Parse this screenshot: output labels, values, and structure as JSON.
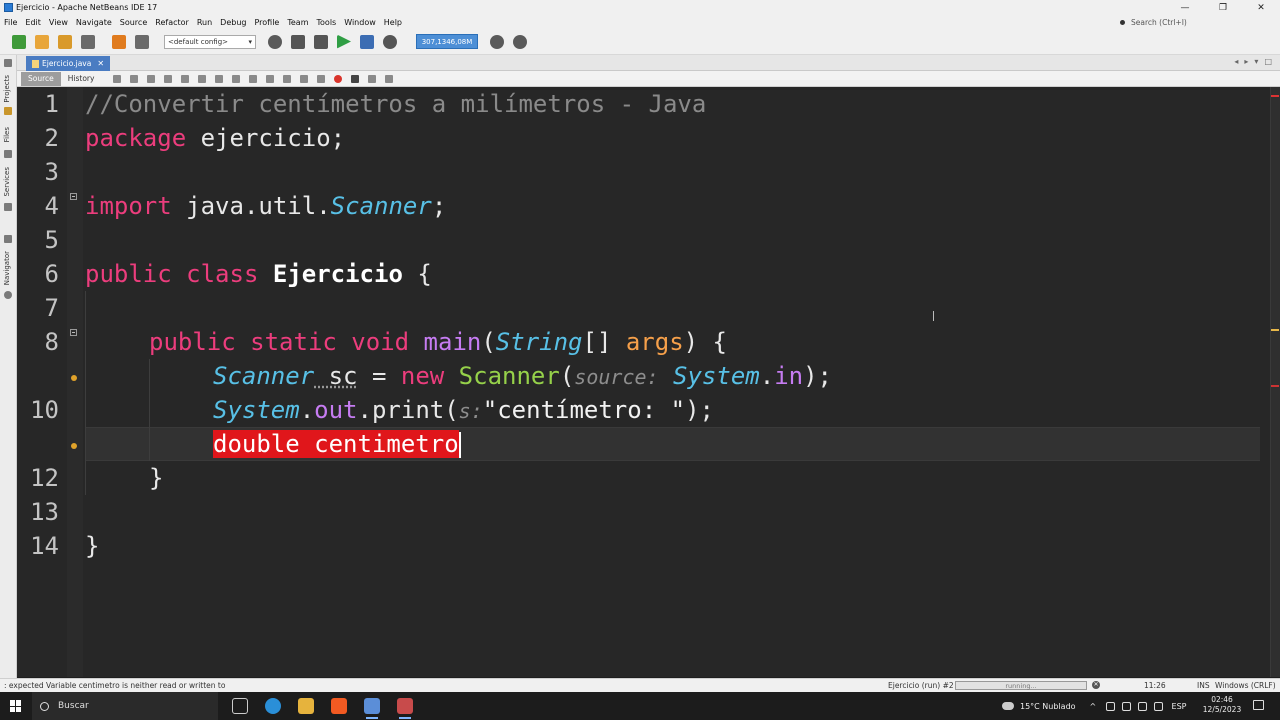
{
  "window": {
    "title": "Ejercicio - Apache NetBeans IDE 17",
    "controls": [
      "—",
      "❐",
      "✕"
    ]
  },
  "menu": {
    "items": [
      "File",
      "Edit",
      "View",
      "Navigate",
      "Source",
      "Refactor",
      "Run",
      "Debug",
      "Profile",
      "Team",
      "Tools",
      "Window",
      "Help"
    ],
    "search_placeholder": "Search (Ctrl+I)"
  },
  "toolbar": {
    "config_value": "<default config>",
    "memory_label": "307,1346,08M",
    "colors": {
      "new_file": "#3f9a3a",
      "new_project": "#e8a63b",
      "open": "#d99a2b",
      "close": "#6a6a6a",
      "undo": "#e07b1e",
      "redo": "#6a6a6a",
      "build": "#555555",
      "clean": "#555555",
      "run": "#2f9e44",
      "debug": "#3c6db3",
      "profile": "#555555",
      "gc": "#5a5a5a"
    }
  },
  "side_panels": [
    "Projects",
    "Files",
    "Services",
    "Navigator"
  ],
  "editor_tab": {
    "file_name": "Ejercicio.java",
    "close": "✕"
  },
  "editor_toolbar": {
    "source_tab": "Source",
    "history_tab": "History"
  },
  "editor": {
    "line_numbers": [
      "1",
      "2",
      "3",
      "4",
      "5",
      "6",
      "7",
      "8",
      "",
      "10",
      "",
      "12",
      "13",
      "14"
    ],
    "lines": {
      "l1": "//Convertir centímetros a milímetros - Java",
      "l2_kw": "package",
      "l2_rest": " ejercicio;",
      "l4_kw": "import",
      "l4_pkg": " java.util.",
      "l4_type": "Scanner",
      "l4_end": ";",
      "l6_kw": "public class ",
      "l6_name": "Ejercicio",
      "l6_end": " {",
      "l8_kw": "public static void ",
      "l8_method": "main",
      "l8_open": "(",
      "l8_type": "String",
      "l8_arr": "[] ",
      "l8_param": "args",
      "l8_end": ") {",
      "l9_type": "Scanner",
      "l9_var": " sc",
      "l9_eq": " = ",
      "l9_new": "new ",
      "l9_cls": "Scanner",
      "l9_open": "(",
      "l9_hint": "source:",
      "l9_sp": " ",
      "l9_sys": "System",
      "l9_dot": ".",
      "l9_in": "in",
      "l9_end": ");",
      "l10_sys": "System",
      "l10_dot": ".",
      "l10_out": "out",
      "l10_print": ".print(",
      "l10_hint": "s:",
      "l10_str": "\"centímetro: \"",
      "l10_end": ");",
      "l11_err": "double centimetro",
      "l12": "}",
      "l14": "}"
    }
  },
  "status": {
    "message": ": expected  Variable centimetro is neither read or written to",
    "task": "Ejercicio (run) #2",
    "progress_label": "running...",
    "position": "11:26",
    "mode": "INS",
    "eol": "Windows (CRLF)"
  },
  "taskbar": {
    "search_label": "Buscar",
    "weather": "15°C  Nublado",
    "language": "ESP",
    "time": "02:46",
    "date": "12/5/2023"
  }
}
